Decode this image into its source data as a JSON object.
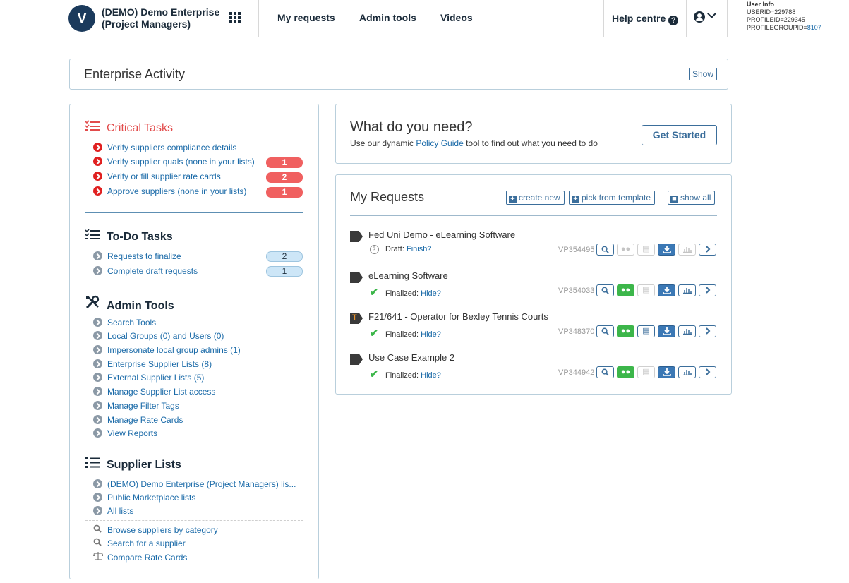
{
  "header": {
    "logo_text": "V",
    "org_line1": "(DEMO) Demo Enterprise",
    "org_line2": "(Project Managers)",
    "nav": [
      "My requests",
      "Admin tools",
      "Videos"
    ],
    "help": "Help centre",
    "user_info": {
      "title": "User Info",
      "userid": "USERID=229788",
      "profileid": "PROFILEID=229345",
      "profilegroup_label": "PROFILEGROUPID=",
      "profilegroup_value": "8107"
    }
  },
  "enterprise": {
    "title": "Enterprise Activity",
    "show": "Show"
  },
  "critical": {
    "title": "Critical Tasks",
    "items": [
      {
        "label": "Verify suppliers compliance details",
        "count": ""
      },
      {
        "label": "Verify supplier quals (none in your lists)",
        "count": "1"
      },
      {
        "label": "Verify or fill supplier rate cards",
        "count": "2"
      },
      {
        "label": "Approve suppliers (none in your lists)",
        "count": "1"
      }
    ]
  },
  "todo": {
    "title": "To-Do Tasks",
    "items": [
      {
        "label": "Requests to finalize",
        "count": "2"
      },
      {
        "label": "Complete draft requests",
        "count": "1"
      }
    ]
  },
  "admin": {
    "title": "Admin Tools",
    "items": [
      "Search Tools",
      "Local Groups (0) and Users (0)",
      "Impersonate local group admins (1)",
      "Enterprise Supplier Lists (8)",
      "External Supplier Lists (5)",
      "Manage Supplier List access",
      "Manage Filter Tags",
      "Manage Rate Cards",
      "View Reports"
    ]
  },
  "supplier_lists": {
    "title": "Supplier Lists",
    "items": [
      "(DEMO) Demo Enterprise (Project Managers) lis...",
      "Public Marketplace lists",
      "All lists"
    ],
    "extra": [
      "Browse suppliers by category",
      "Search for a supplier",
      "Compare Rate Cards"
    ]
  },
  "need": {
    "title": "What do you need?",
    "sub_before": "Use our dynamic ",
    "sub_link": "Policy Guide",
    "sub_after": " tool to find out what you need to do",
    "button": "Get Started"
  },
  "my_requests": {
    "title": "My Requests",
    "create_new": "create new",
    "pick_template": "pick from template",
    "show_all": "show all",
    "rows": [
      {
        "name": "Fed Uni Demo - eLearning Software",
        "status": "Draft:",
        "status_link": "Finish?",
        "vp": "VP354495",
        "state": "draft"
      },
      {
        "name": "eLearning Software",
        "status": "Finalized:",
        "status_link": "Hide?",
        "vp": "VP354033",
        "state": "final"
      },
      {
        "name": "F21/641 - Operator for Bexley Tennis Courts",
        "status": "Finalized:",
        "status_link": "Hide?",
        "vp": "VP348370",
        "state": "final"
      },
      {
        "name": "Use Case Example 2",
        "status": "Finalized:",
        "status_link": "Hide?",
        "vp": "VP344942",
        "state": "final"
      }
    ]
  }
}
